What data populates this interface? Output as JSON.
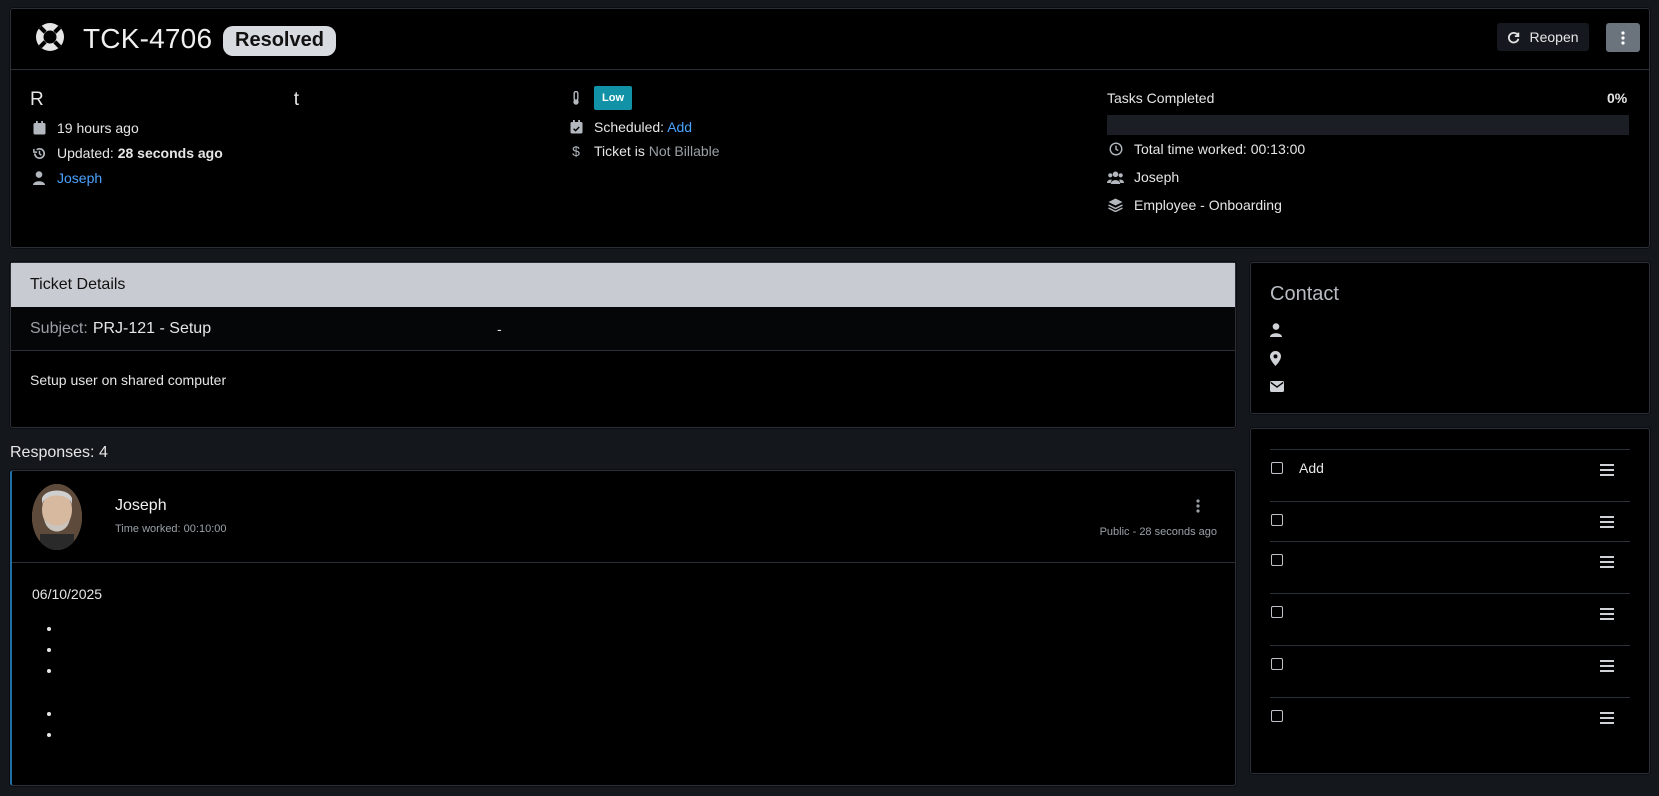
{
  "header": {
    "ticket_id": "TCK-4706",
    "status": "Resolved",
    "reopen_label": "Reopen",
    "title_fragment_left": "R",
    "title_fragment_right": "t",
    "created": "19 hours ago",
    "updated_label": "Updated:",
    "updated_value": "28 seconds ago",
    "assignee": "Joseph",
    "priority": "Low",
    "scheduled_label": "Scheduled:",
    "scheduled_action": "Add",
    "billable_label": "Ticket is",
    "billable_value": "Not Billable",
    "tasks_completed_label": "Tasks Completed",
    "tasks_completed_pct": "0%",
    "tasks_completed_fraction": 0,
    "total_time": "Total time worked: 00:13:00",
    "team": "Joseph",
    "category": "Employee - Onboarding"
  },
  "details": {
    "heading": "Ticket Details",
    "subject_label": "Subject:",
    "subject_value": "PRJ-121 - Setup",
    "subject_extra": "-",
    "body": "Setup user on shared computer"
  },
  "contact": {
    "title": "Contact"
  },
  "tasks": {
    "items": [
      {
        "label": "Add"
      },
      {
        "label": ""
      },
      {
        "label": ""
      },
      {
        "label": ""
      },
      {
        "label": ""
      },
      {
        "label": ""
      }
    ]
  },
  "responses": {
    "title": "Responses: 4",
    "items": [
      {
        "author": "Joseph",
        "time_worked": "Time worked: 00:10:00",
        "meta": "Public - 28 seconds ago",
        "date": "06/10/2025"
      }
    ]
  },
  "colors": {
    "accent_link": "#4aa3ff",
    "priority_low": "#1292a7",
    "status_pill": "#d8dbe0"
  }
}
